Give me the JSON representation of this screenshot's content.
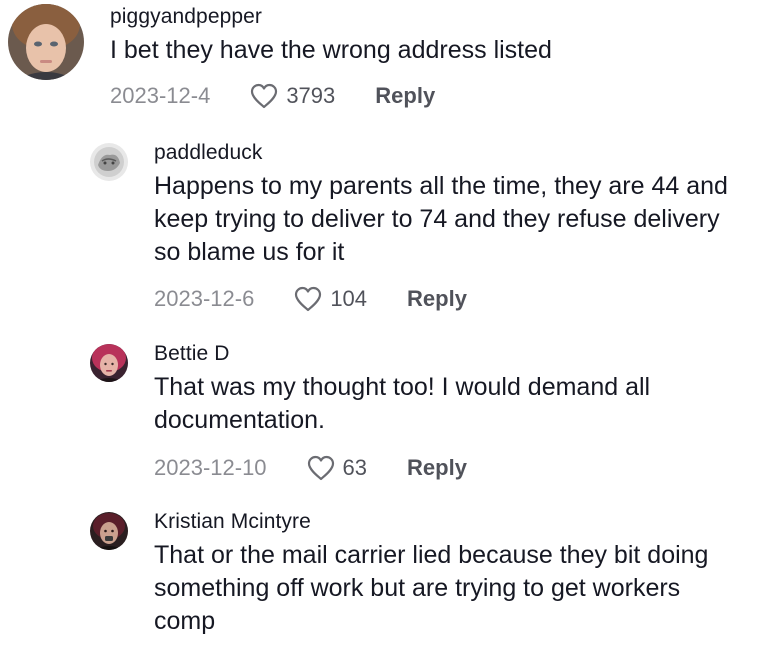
{
  "comments": [
    {
      "username": "piggyandpepper",
      "text": "I bet they have the wrong address listed",
      "date": "2023-12-4",
      "likes": "3793",
      "reply_label": "Reply"
    },
    {
      "username": "paddleduck",
      "text_lines": [
        "Happens to my parents all the time, they are 44 and",
        "keep trying to deliver to 74 and they refuse delivery",
        "so blame us for it"
      ],
      "date": "2023-12-6",
      "likes": "104",
      "reply_label": "Reply"
    },
    {
      "username": "Bettie D",
      "text_lines": [
        "That was my thought too! I would demand all",
        "documentation."
      ],
      "date": "2023-12-10",
      "likes": "63",
      "reply_label": "Reply"
    },
    {
      "username": "Kristian Mcintyre",
      "text_lines": [
        "That or the mail carrier lied because they bit doing",
        "something off work but are trying to get workers",
        "comp"
      ]
    }
  ],
  "icons": {
    "like": "heart-icon"
  },
  "colors": {
    "text": "#161823",
    "secondary": "#8a8b91",
    "background": "#ffffff"
  }
}
